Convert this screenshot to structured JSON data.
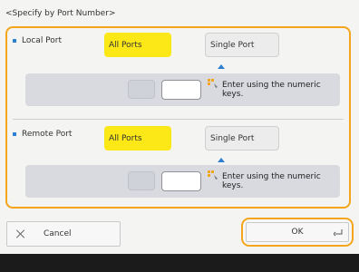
{
  "header": {
    "title": "<Specify by Port Number>"
  },
  "local_port": {
    "label": "Local Port",
    "all_ports_label": "All Ports",
    "single_port_label": "Single Port",
    "value": "",
    "hint": "Enter using the numeric keys."
  },
  "remote_port": {
    "label": "Remote Port",
    "all_ports_label": "All Ports",
    "single_port_label": "Single Port",
    "value": "",
    "hint": "Enter using the numeric keys."
  },
  "footer": {
    "cancel_label": "Cancel",
    "ok_label": "OK"
  },
  "colors": {
    "accent_border": "#f4a51c",
    "selected_button": "#fbe816",
    "bullet": "#2f7fd1"
  }
}
